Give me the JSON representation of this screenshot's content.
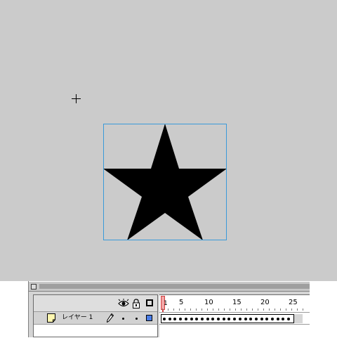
{
  "stage": {
    "background_color": "#cbcbcb",
    "selection_color": "#3a9ad9",
    "shape": "star",
    "shape_fill": "#000000"
  },
  "timeline": {
    "header_icons": [
      "eye-icon",
      "lock-icon",
      "outline-icon"
    ],
    "playhead_frame": "1",
    "ruler_labels": [
      "5",
      "10",
      "15",
      "20",
      "25"
    ],
    "layer": {
      "name": "レイヤー 1",
      "color": "#4a7de6",
      "frame_count": 24
    }
  }
}
